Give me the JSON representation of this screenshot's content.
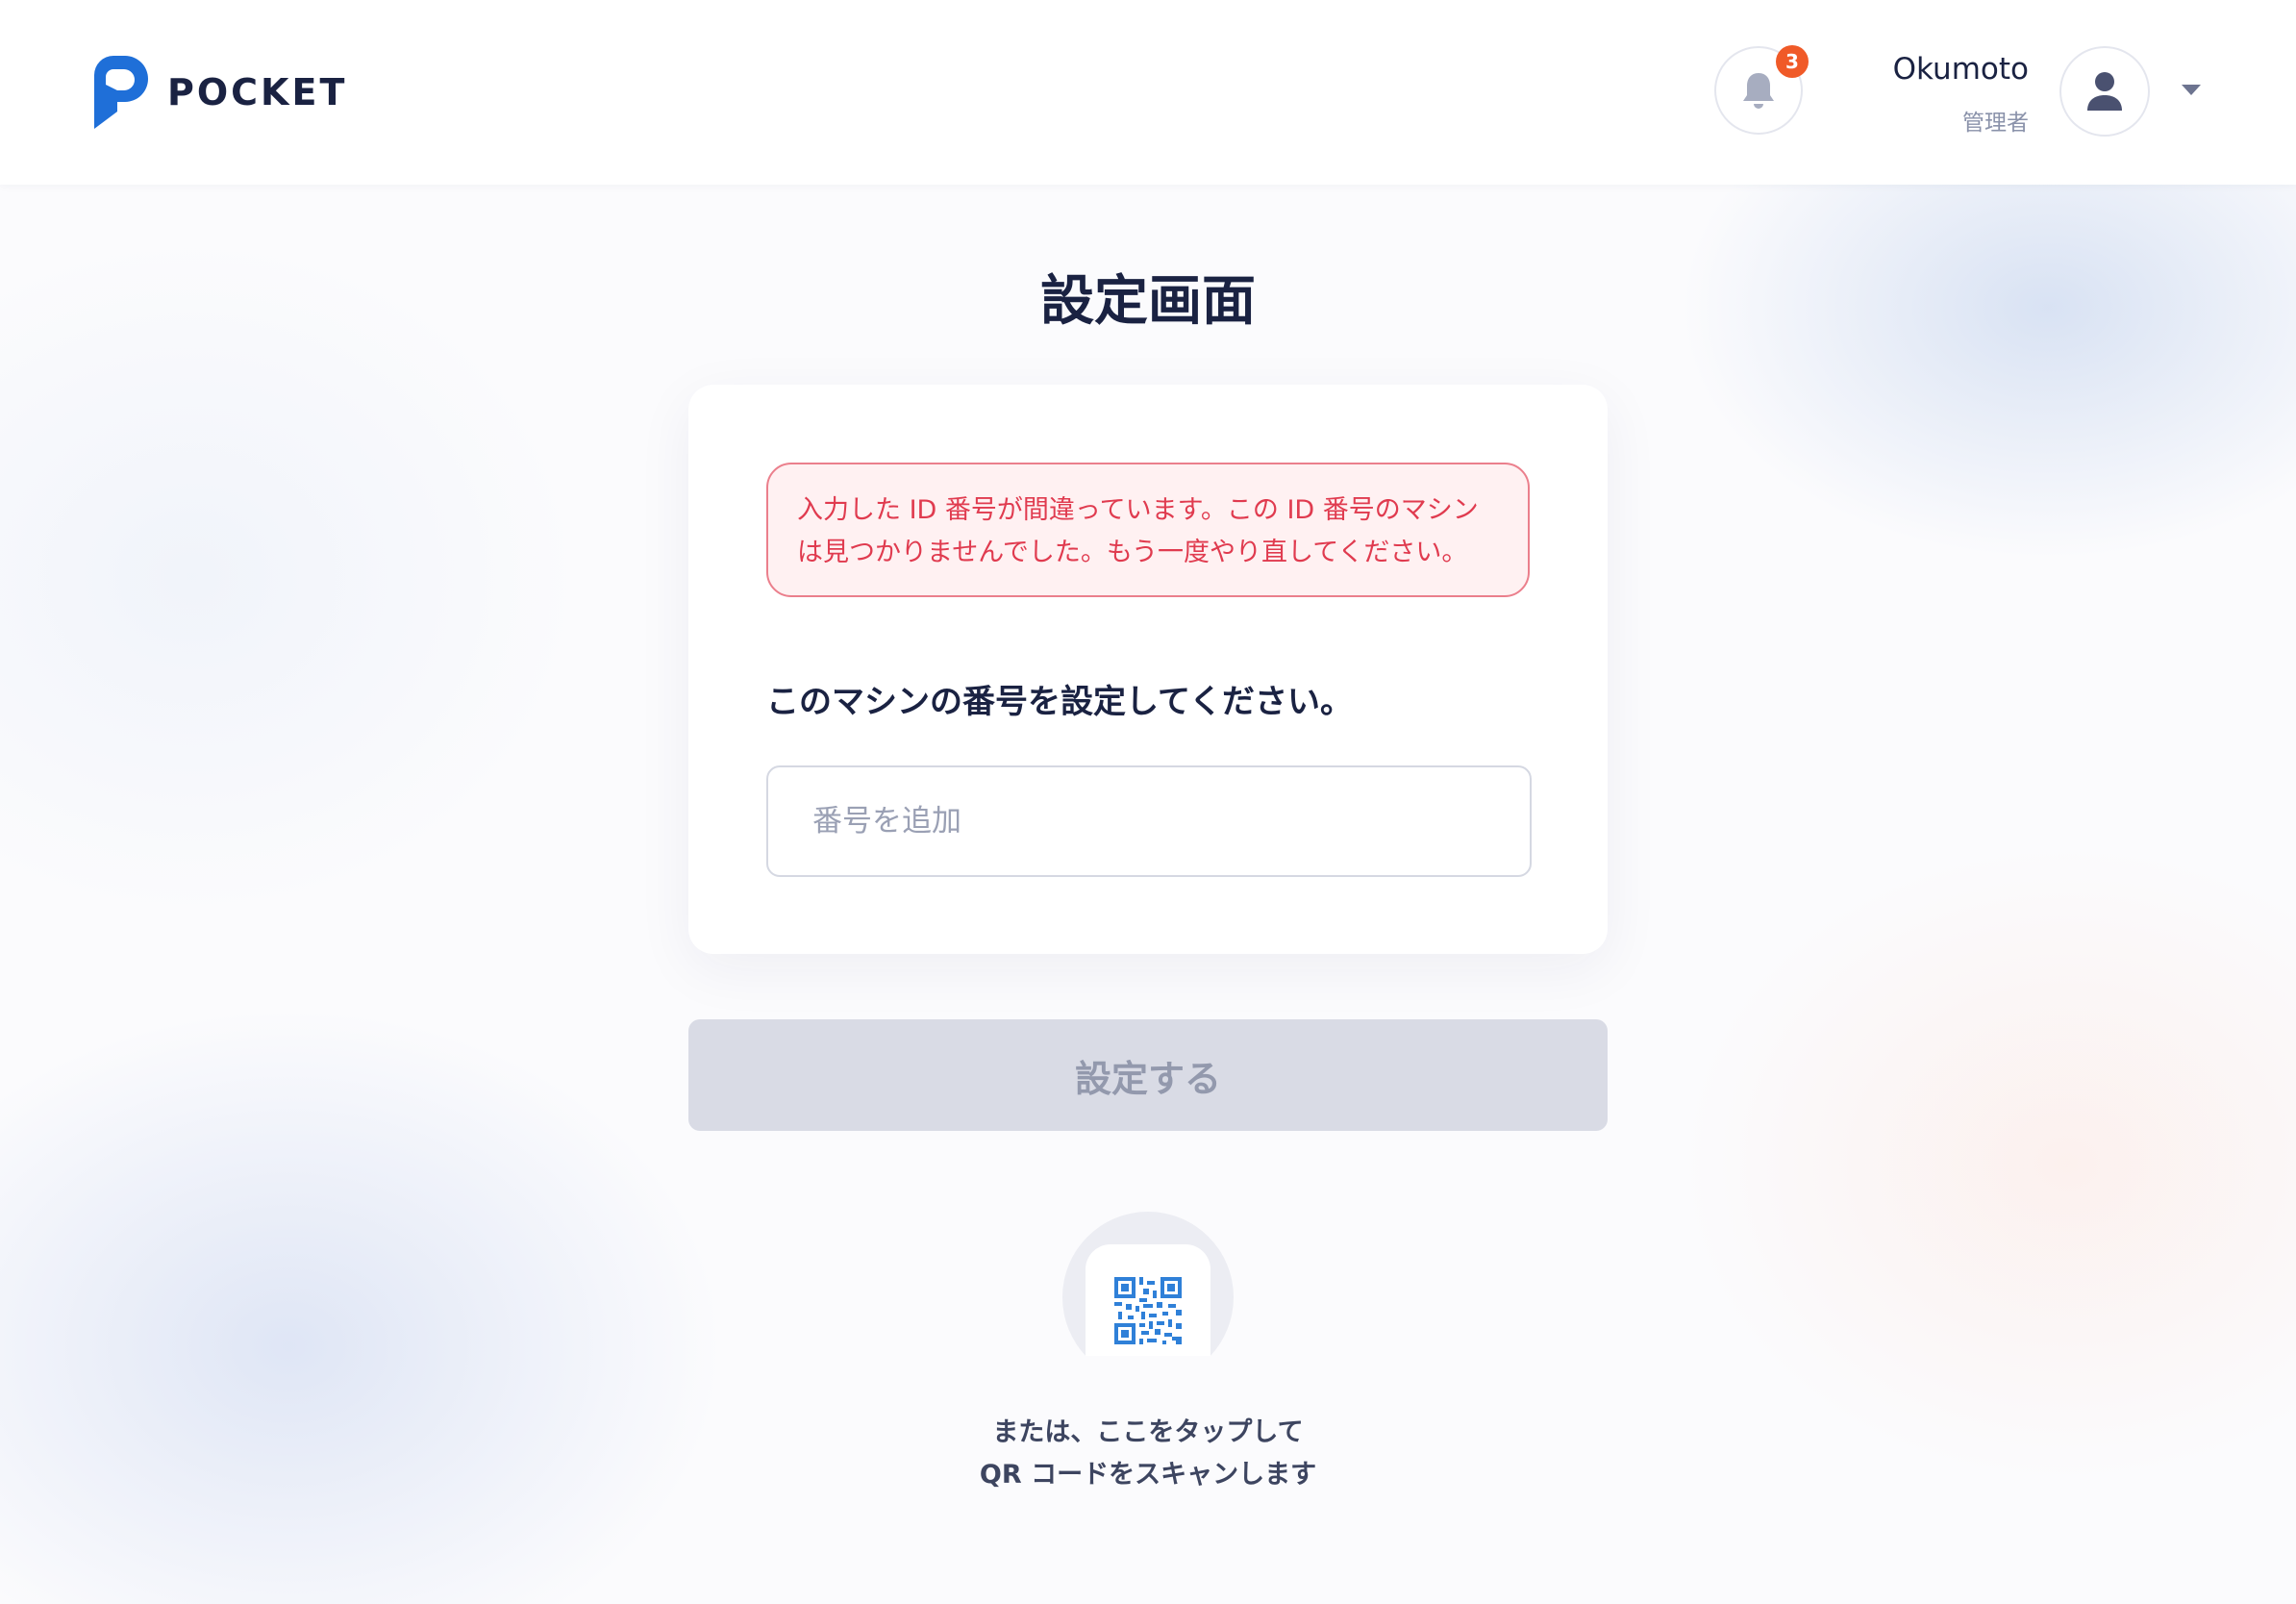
{
  "header": {
    "logo_text": "POCKET",
    "notification_count": "3",
    "user_name": "Okumoto",
    "user_role": "管理者"
  },
  "page": {
    "title": "設定画面"
  },
  "error": {
    "line1": "入力した ID 番号が間違っています。この ID 番号のマシン",
    "line2": "は見つかりませんでした。もう一度やり直してください。"
  },
  "form": {
    "label": "このマシンの番号を設定してください。",
    "input_value": "",
    "input_placeholder": "番号を追加",
    "submit_label": "設定する"
  },
  "qr": {
    "line1": "または、ここをタップして",
    "line2": "QR コードをスキャンします"
  },
  "colors": {
    "brand": "#1f6fd8",
    "error": "#e03b4f",
    "badge": "#f05a28",
    "disabled_button": "#d9dbe5"
  }
}
